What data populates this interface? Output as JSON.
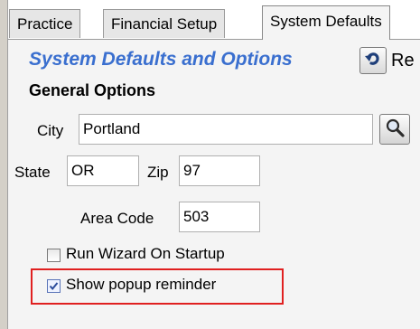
{
  "tabs": [
    {
      "label": "Practice",
      "active": false
    },
    {
      "label": "Financial Setup",
      "active": false
    },
    {
      "label": "System Defaults",
      "active": true
    }
  ],
  "header": {
    "title": "System Defaults and Options",
    "undo_label": "Re",
    "undo_icon": "undo-icon",
    "title_color": "#3a6fcf"
  },
  "general": {
    "section_label": "General Options",
    "city_label": "City",
    "city_value": "Portland",
    "search_icon": "magnifier-icon",
    "state_label": "State",
    "state_value": "OR",
    "zip_label": "Zip",
    "zip_value": "97",
    "area_code_label": "Area Code",
    "area_code_value": "503",
    "run_wizard_label": "Run Wizard On Startup",
    "run_wizard_checked": false,
    "show_popup_label": "Show popup reminder",
    "show_popup_checked": true,
    "highlight_color": "#e02020"
  }
}
